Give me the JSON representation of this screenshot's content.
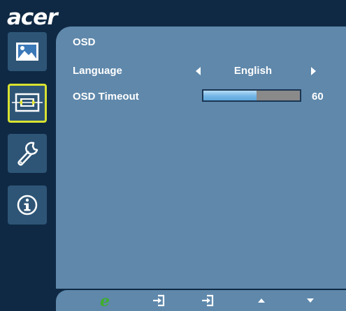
{
  "brand": {
    "logo_text": "acer"
  },
  "colors": {
    "background": "#0f2944",
    "panel": "#5f88ab",
    "selection_border": "#d8e230",
    "progress_fill": "#74b6e6",
    "progress_track": "#8a8a8a",
    "e_icon_green": "#3fae2a"
  },
  "sidebar": {
    "items": [
      {
        "icon": "picture-icon",
        "selected": false
      },
      {
        "icon": "display-position-icon",
        "selected": true
      },
      {
        "icon": "wrench-settings-icon",
        "selected": false
      },
      {
        "icon": "info-icon",
        "selected": false
      }
    ]
  },
  "main": {
    "title": "OSD",
    "language": {
      "label": "Language",
      "value": "English"
    },
    "osd_timeout": {
      "label": "OSD Timeout",
      "value": "60",
      "fill_fraction": 0.55
    }
  },
  "bottom_bar": {
    "buttons": [
      {
        "icon": "e-icon"
      },
      {
        "icon": "input-icon"
      },
      {
        "icon": "input-icon"
      },
      {
        "icon": "up-arrow-icon"
      },
      {
        "icon": "down-arrow-icon"
      }
    ]
  }
}
